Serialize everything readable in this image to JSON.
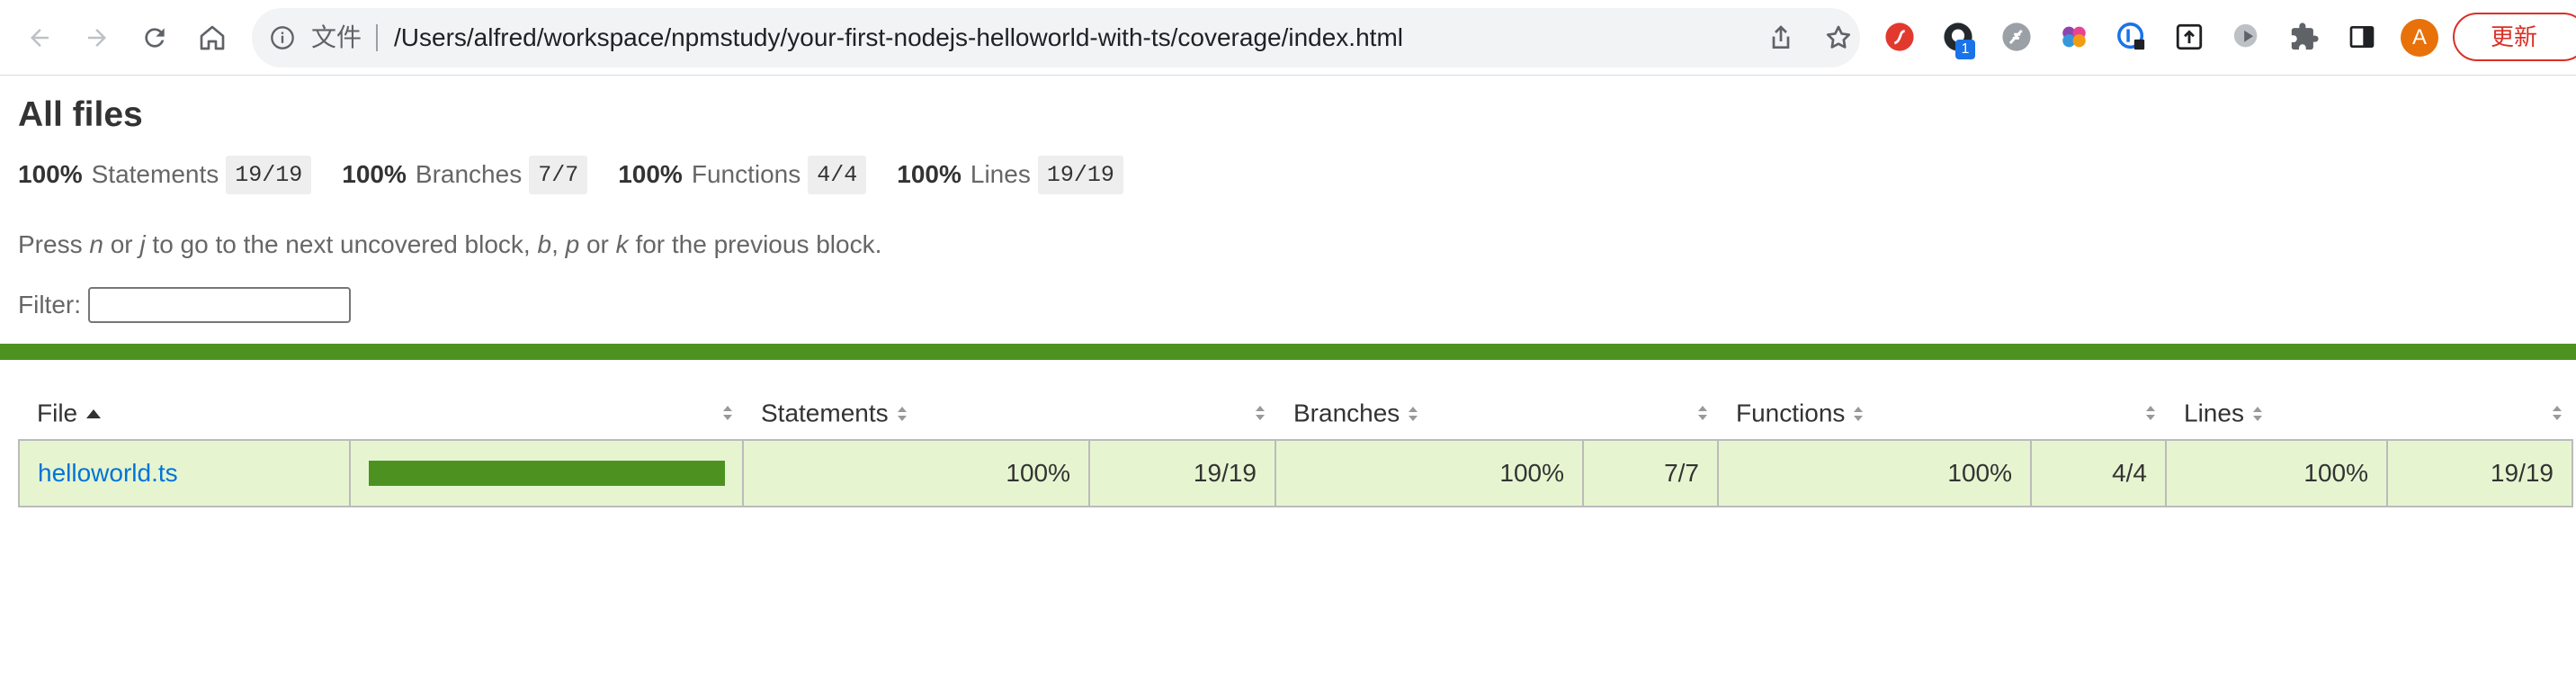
{
  "browser": {
    "omnibox_label": "文件",
    "url": "/Users/alfred/workspace/npmstudy/your-first-nodejs-helloworld-with-ts/coverage/index.html",
    "extensions": [
      "flash-ext-icon",
      "github-ext-icon",
      "feather-ext-icon",
      "brain-ext-icon",
      "password-lock-ext-icon",
      "upload-ext-icon",
      "media-ext-icon",
      "puzzle-extensions-icon",
      "side-panel-icon"
    ],
    "extension_badge": "1",
    "avatar_letter": "A",
    "update_label": "更新",
    "colors": {
      "accent_red": "#d93025",
      "avatar": "#e8710a",
      "badge": "#1a73e8"
    }
  },
  "report": {
    "title": "All files",
    "summary": [
      {
        "pct": "100%",
        "label": "Statements",
        "fraction": "19/19"
      },
      {
        "pct": "100%",
        "label": "Branches",
        "fraction": "7/7"
      },
      {
        "pct": "100%",
        "label": "Functions",
        "fraction": "4/4"
      },
      {
        "pct": "100%",
        "label": "Lines",
        "fraction": "19/19"
      }
    ],
    "hint": {
      "press": "Press ",
      "n": "n",
      "or1": " or ",
      "j": "j",
      "mid": " to go to the next uncovered block, ",
      "b": "b",
      "comma": ", ",
      "p": "p",
      "or2": " or ",
      "k": "k",
      "end": " for the previous block."
    },
    "filter_label": "Filter:",
    "filter_value": "",
    "status_color": "#4d9221",
    "table": {
      "headers": {
        "file": "File",
        "statements": "Statements",
        "branches": "Branches",
        "functions": "Functions",
        "lines": "Lines"
      },
      "rows": [
        {
          "file": "helloworld.ts",
          "coverage_fraction": 1.0,
          "statements_pct": "100%",
          "statements_frac": "19/19",
          "branches_pct": "100%",
          "branches_frac": "7/7",
          "functions_pct": "100%",
          "functions_frac": "4/4",
          "lines_pct": "100%",
          "lines_frac": "19/19"
        }
      ]
    }
  }
}
